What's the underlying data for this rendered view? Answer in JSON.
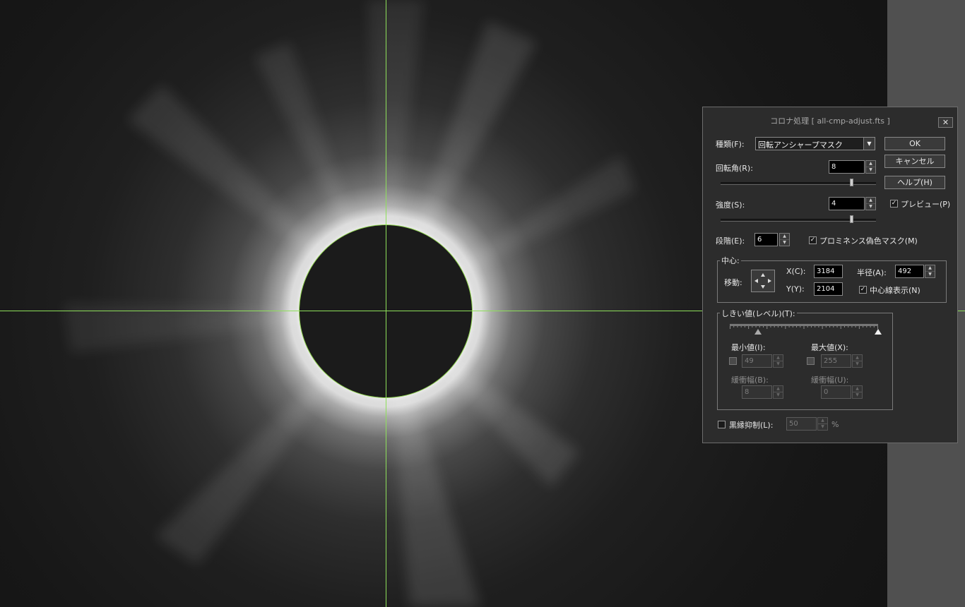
{
  "dialog": {
    "title": "コロナ処理 [ all-cmp-adjust.fts ]",
    "close_glyph": "✕",
    "type_label": "種類(F):",
    "type_value": "回転アンシャープマスク",
    "ok_label": "OK",
    "cancel_label": "キャンセル",
    "help_label": "ヘルプ(H)",
    "rotation_label": "回転角(R):",
    "rotation_value": "8",
    "rotation_slider_fraction": 0.84,
    "strength_label": "強度(S):",
    "strength_value": "4",
    "strength_slider_fraction": 0.84,
    "preview_label": "プレビュー(P)",
    "preview_checked": true,
    "steps_label": "段階(E):",
    "steps_value": "6",
    "prominence_label": "プロミネンス偽色マスク(M)",
    "prominence_checked": true,
    "center_group_label": "中心:",
    "move_label": "移動:",
    "x_label": "X(C):",
    "x_value": "3184",
    "y_label": "Y(Y):",
    "y_value": "2104",
    "radius_label": "半径(A):",
    "radius_value": "492",
    "center_line_label": "中心線表示(N)",
    "center_line_checked": true,
    "threshold_group_label": "しきい値(レベル)(T):",
    "threshold_min_fraction": 0.19,
    "threshold_max_fraction": 1.0,
    "min_label": "最小値(I):",
    "min_value": "49",
    "min_checked": false,
    "max_label": "最大値(X):",
    "max_value": "255",
    "max_checked": false,
    "buffer1_label": "緩衝幅(B):",
    "buffer1_value": "8",
    "buffer2_label": "緩衝幅(U):",
    "buffer2_value": "0",
    "black_edge_label": "黒縁抑制(L):",
    "black_edge_value": "50",
    "black_edge_checked": false,
    "percent_unit": "%"
  },
  "colors": {
    "guide_line": "#8ee05a",
    "dialog_bg": "#2c2c2c",
    "side_panel": "#505050"
  }
}
